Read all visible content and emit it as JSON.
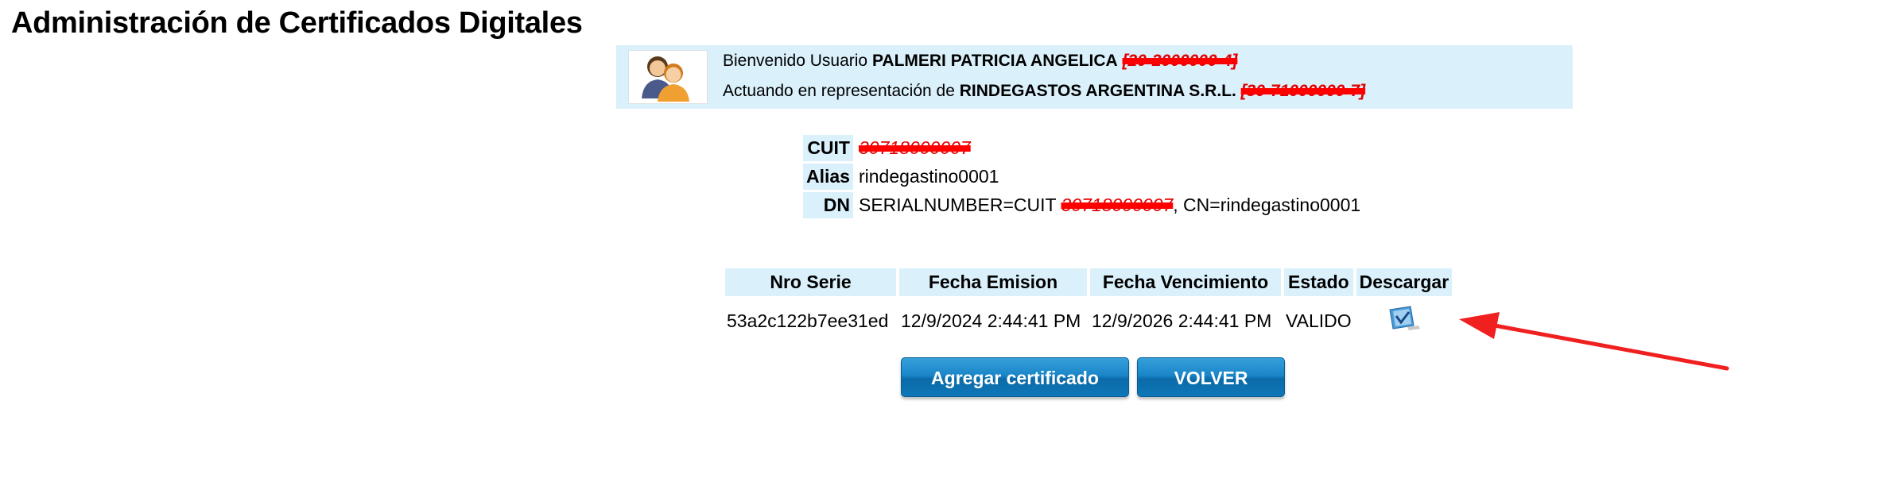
{
  "page": {
    "title": "Administración de Certificados Digitales"
  },
  "user_panel": {
    "welcome_prefix": "Bienvenido Usuario",
    "user_name": "PALMERI PATRICIA ANGELICA",
    "user_id_redacted": "[20-2000000-4]",
    "acting_prefix": "Actuando en representación de",
    "company_name": "RINDEGASTOS ARGENTINA S.R.L.",
    "company_id_redacted": "[30-71000000-7]"
  },
  "info": [
    {
      "label": "CUIT",
      "value": "30718000007",
      "redacted": true
    },
    {
      "label": "Alias",
      "value": "rindegastino0001",
      "redacted": false
    },
    {
      "label": "DN",
      "value_prefix": "SERIALNUMBER=CUIT ",
      "value_redacted": "30718000007",
      "value_suffix": ", CN=rindegastino0001"
    }
  ],
  "cert_table": {
    "columns": [
      "Nro Serie",
      "Fecha Emision",
      "Fecha Vencimiento",
      "Estado",
      "Descargar"
    ],
    "rows": [
      {
        "serial": "53a2c122b7ee31ed",
        "issued": "12/9/2024 2:44:41 PM",
        "expires": "12/9/2026 2:44:41 PM",
        "status": "VALIDO",
        "download_icon": "certificate-download-icon"
      }
    ]
  },
  "buttons": {
    "add": "Agregar certificado",
    "back": "VOLVER"
  },
  "colors": {
    "panel_bg": "#daf0fb",
    "button_blue": "#1a86c8",
    "annotation_red": "#f02020"
  }
}
